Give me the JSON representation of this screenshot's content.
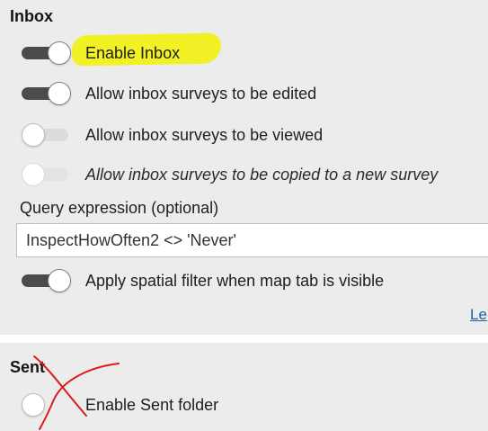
{
  "inbox": {
    "title": "Inbox",
    "toggles": [
      {
        "label": "Enable Inbox",
        "state": "on"
      },
      {
        "label": "Allow inbox surveys to be edited",
        "state": "on"
      },
      {
        "label": "Allow inbox surveys to be viewed",
        "state": "off"
      },
      {
        "label": "Allow inbox surveys to be copied to a new survey",
        "state": "disabled-off"
      }
    ],
    "query": {
      "label": "Query expression (optional)",
      "value": "InspectHowOften2 <> 'Never'"
    },
    "spatial_filter": {
      "label": "Apply spatial filter when map tab is visible",
      "state": "on"
    },
    "link_text": "Le"
  },
  "sent": {
    "title": "Sent",
    "toggle": {
      "label": "Enable Sent folder",
      "state": "off"
    }
  },
  "annotations": {
    "highlight_color": "#f2f20f",
    "scribble_color": "#e0191f"
  }
}
